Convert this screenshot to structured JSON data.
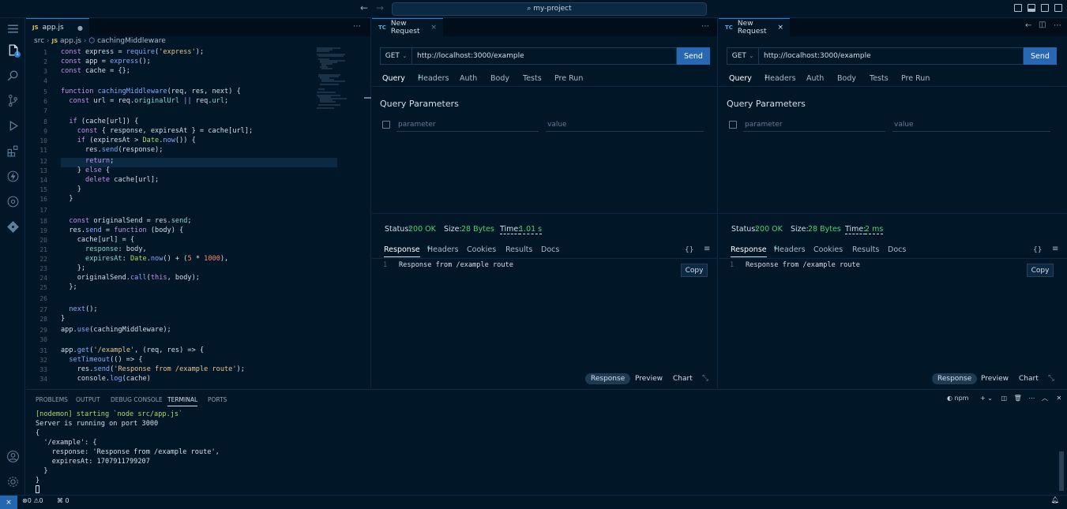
{
  "titlebar": {
    "search": "my-project",
    "back": "←",
    "forward": "→"
  },
  "activity": {
    "scm_badge": "1"
  },
  "editor": {
    "tab_label": "app.js",
    "tab_badge": "JS",
    "crumbs": {
      "folder": "src",
      "file": "app.js",
      "symbol": "cachingMiddleware"
    },
    "line_numbers": [
      "1",
      "2",
      "3",
      "4",
      "5",
      "6",
      "7",
      "8",
      "9",
      "10",
      "11",
      "12",
      "13",
      "14",
      "15",
      "16",
      "17",
      "18",
      "19",
      "20",
      "21",
      "22",
      "23",
      "24",
      "25",
      "26",
      "27",
      "28",
      "29",
      "30",
      "31",
      "32",
      "33",
      "34"
    ]
  },
  "request": {
    "tab_label": "New Request",
    "tab_badge": "TC",
    "method": "GET",
    "url": "http://localhost:3000/example",
    "send_label": "Send",
    "tabs": [
      "Query",
      "Headers",
      "Auth",
      "Body",
      "Tests",
      "Pre Run"
    ],
    "headers_count": "2",
    "query_title": "Query Parameters",
    "param_placeholder": "parameter",
    "value_placeholder": "value",
    "status_label": "Status:",
    "status_value": "200 OK",
    "size_label": "Size:",
    "size_value": "28 Bytes",
    "time_label": "Time:",
    "time_value_1": "1.01 s",
    "time_value_2": "2 ms",
    "response_tabs": [
      "Response",
      "Headers",
      "Cookies",
      "Results",
      "Docs"
    ],
    "response_headers_count": "6",
    "response_line_no": "1",
    "response_text": "Response from /example route",
    "copy_label": "Copy",
    "bottom_tabs": [
      "Response",
      "Preview",
      "Chart"
    ],
    "braces": "{}"
  },
  "terminal": {
    "tabs": [
      "PROBLEMS",
      "OUTPUT",
      "DEBUG CONSOLE",
      "TERMINAL",
      "PORTS"
    ],
    "shell": "npm",
    "lines": [
      "[nodemon] starting `node src/app.js`",
      "Server is running on port 3000",
      "{",
      "  '/example': {",
      "    response: 'Response from /example route',",
      "    expiresAt: 1707911799207",
      "  }",
      "}"
    ]
  },
  "statusbar": {
    "errors": "0",
    "warnings": "0",
    "ports": "0"
  },
  "colors": {
    "accent": "#2867b4",
    "background": "#011627",
    "ok": "#4fd46c"
  }
}
